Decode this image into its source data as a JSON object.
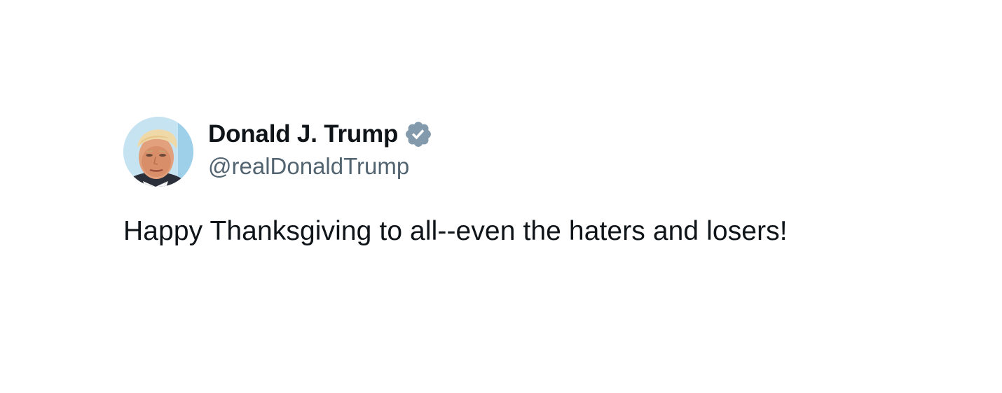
{
  "tweet": {
    "author": {
      "display_name": "Donald J. Trump",
      "handle": "@realDonaldTrump",
      "verified": true,
      "avatar_icon": "profile-photo",
      "verified_icon": "verified-badge-icon"
    },
    "text": "Happy Thanksgiving to all--even the haters and losers!"
  },
  "colors": {
    "background": "#ffffff",
    "primary_text": "#0f1419",
    "secondary_text": "#536471",
    "verified_badge": "#829aab"
  }
}
